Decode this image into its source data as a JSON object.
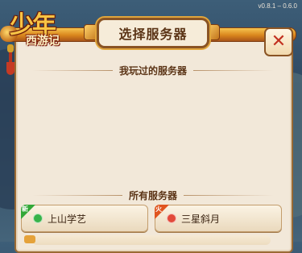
{
  "version": "v0.8.1 – 0.6.0",
  "logo": {
    "main": "少年",
    "sub": "西游记"
  },
  "dialog": {
    "title": "选择服务器",
    "close_icon": "close-icon"
  },
  "sections": {
    "recent": "我玩过的服务器",
    "all": "所有服务器"
  },
  "servers": [
    {
      "name": "上山学艺",
      "badge": "新",
      "badge_color": "#33a838",
      "status_color": "#37b34a"
    },
    {
      "name": "三星斜月",
      "badge": "火",
      "badge_color": "#e0541f",
      "status_color": "#e24a3a"
    }
  ]
}
